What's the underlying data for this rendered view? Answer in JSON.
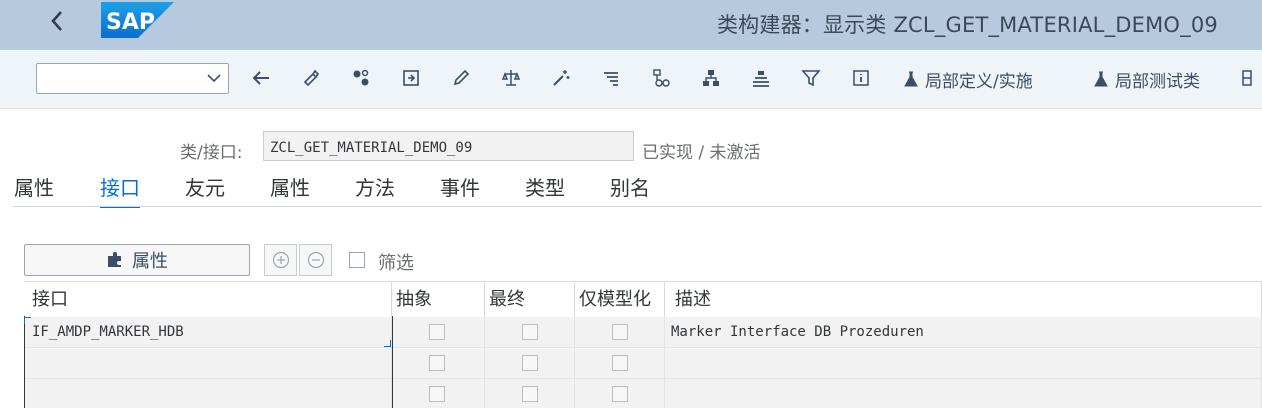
{
  "header": {
    "back_icon": "chevron-left-icon",
    "logo_text": "SAP",
    "title": "类构建器：显示类 ZCL_GET_MATERIAL_DEMO_09",
    "brand_color": "#0a6ed1"
  },
  "toolbar": {
    "command_value": "",
    "icons": [
      "arrow-left-icon",
      "other-object-icon",
      "where-used-icon",
      "activate-icon",
      "edit-icon",
      "balance-icon",
      "magic-wand-icon",
      "filter-list-icon",
      "hierarchy-icon",
      "tree-icon",
      "stack-icon",
      "funnel-icon",
      "info-icon"
    ],
    "local_defs_label": "局部定义/实施",
    "local_tests_label": "局部测试类"
  },
  "class_field": {
    "label": "类/接口:",
    "value": "ZCL_GET_MATERIAL_DEMO_09",
    "status": "已实现 / 未激活"
  },
  "tabs": [
    {
      "label": "属性",
      "active": false
    },
    {
      "label": "接口",
      "active": true
    },
    {
      "label": "友元",
      "active": false
    },
    {
      "label": "属性",
      "active": false
    },
    {
      "label": "方法",
      "active": false
    },
    {
      "label": "事件",
      "active": false
    },
    {
      "label": "类型",
      "active": false
    },
    {
      "label": "别名",
      "active": false
    }
  ],
  "subtoolbar": {
    "attr_button_label": "属性",
    "filter_label": "筛选"
  },
  "table": {
    "columns": [
      "接口",
      "抽象",
      "最终",
      "仅模型化",
      "描述"
    ],
    "rows": [
      {
        "interface": "IF_AMDP_MARKER_HDB",
        "abstract": false,
        "final": false,
        "modeled_only": false,
        "description": "Marker Interface DB Prozeduren"
      },
      {
        "interface": "",
        "abstract": false,
        "final": false,
        "modeled_only": false,
        "description": ""
      },
      {
        "interface": "",
        "abstract": false,
        "final": false,
        "modeled_only": false,
        "description": ""
      }
    ]
  }
}
